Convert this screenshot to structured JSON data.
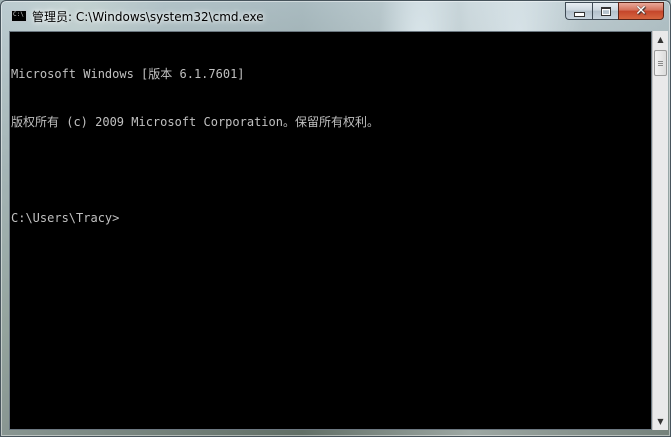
{
  "window": {
    "title": "管理员: C:\\Windows\\system32\\cmd.exe",
    "icon_text": "C:\\",
    "icon": "console-app-icon",
    "buttons": {
      "minimize_icon": "minimize-icon",
      "maximize_icon": "maximize-icon",
      "close_icon": "close-icon",
      "close_glyph": "✕"
    }
  },
  "console": {
    "background": "#000000",
    "foreground": "#c0c0c0",
    "lines": [
      "Microsoft Windows [版本 6.1.7601]",
      "版权所有 (c) 2009 Microsoft Corporation。保留所有权利。",
      "",
      "C:\\Users\\Tracy>"
    ]
  },
  "scrollbar": {
    "up_glyph": "▲",
    "down_glyph": "▼"
  }
}
